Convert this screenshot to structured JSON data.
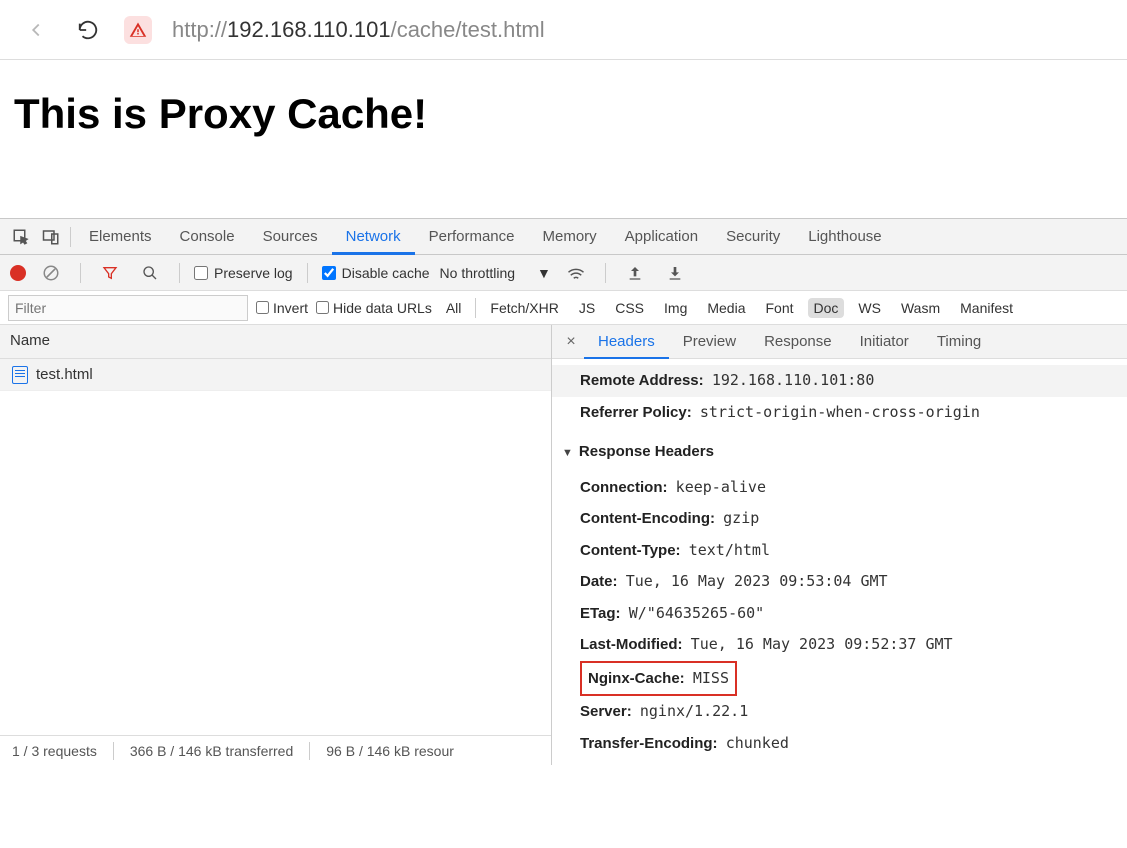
{
  "url": {
    "prefix": "http://",
    "host": "192.168.110.101",
    "path": "/cache/test.html"
  },
  "page": {
    "heading": "This is Proxy Cache!"
  },
  "devtools": {
    "tabs": [
      "Elements",
      "Console",
      "Sources",
      "Network",
      "Performance",
      "Memory",
      "Application",
      "Security",
      "Lighthouse"
    ],
    "activeTab": "Network"
  },
  "netToolbar": {
    "preserveLog": "Preserve log",
    "disableCache": "Disable cache",
    "throttling": "No throttling"
  },
  "filterBar": {
    "filterPlaceholder": "Filter",
    "invert": "Invert",
    "hideData": "Hide data URLs",
    "types": [
      "All",
      "Fetch/XHR",
      "JS",
      "CSS",
      "Img",
      "Media",
      "Font",
      "Doc",
      "WS",
      "Wasm",
      "Manifest"
    ],
    "activeType": "Doc"
  },
  "requestList": {
    "columnHeader": "Name",
    "items": [
      "test.html"
    ]
  },
  "statusBar": {
    "requests": "1 / 3 requests",
    "transferred": "366 B / 146 kB transferred",
    "resources": "96 B / 146 kB resour"
  },
  "detail": {
    "tabs": [
      "Headers",
      "Preview",
      "Response",
      "Initiator",
      "Timing"
    ],
    "activeTab": "Headers",
    "general": [
      {
        "k": "Remote Address:",
        "v": "192.168.110.101:80",
        "grey": true
      },
      {
        "k": "Referrer Policy:",
        "v": "strict-origin-when-cross-origin"
      }
    ],
    "responseSection": "Response Headers",
    "responseHeaders": [
      {
        "k": "Connection:",
        "v": "keep-alive"
      },
      {
        "k": "Content-Encoding:",
        "v": "gzip"
      },
      {
        "k": "Content-Type:",
        "v": "text/html"
      },
      {
        "k": "Date:",
        "v": "Tue, 16 May 2023 09:53:04 GMT"
      },
      {
        "k": "ETag:",
        "v": "W/\"64635265-60\""
      },
      {
        "k": "Last-Modified:",
        "v": "Tue, 16 May 2023 09:52:37 GMT"
      },
      {
        "k": "Nginx-Cache:",
        "v": "MISS",
        "highlight": true
      },
      {
        "k": "Server:",
        "v": "nginx/1.22.1"
      },
      {
        "k": "Transfer-Encoding:",
        "v": "chunked"
      }
    ]
  }
}
